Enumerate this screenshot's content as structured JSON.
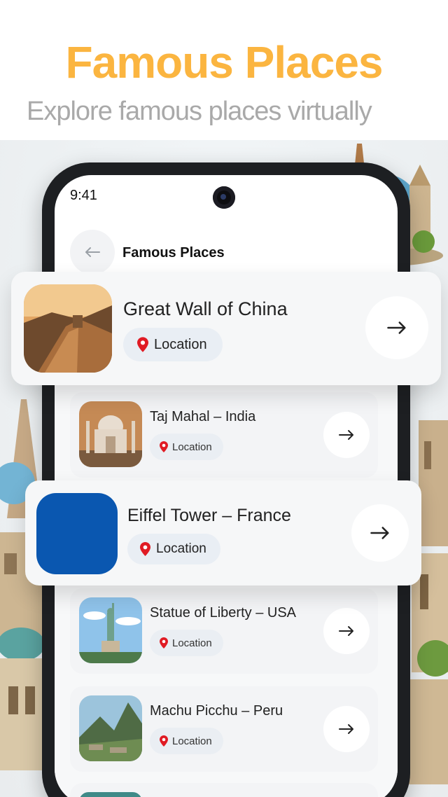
{
  "hero": {
    "title": "Famous Places",
    "subtitle": "Explore famous places virtually"
  },
  "status_bar": {
    "time": "9:41"
  },
  "header": {
    "back_icon": "arrow-left-icon",
    "title": "Famous Places"
  },
  "featured_cards": [
    {
      "title": "Great Wall of China",
      "location_label": "Location"
    },
    {
      "title": "Eiffel Tower – France",
      "location_label": "Location"
    }
  ],
  "places": [
    {
      "title": "Taj Mahal – India",
      "location_label": "Location"
    },
    {
      "title": "Statue of Liberty – USA",
      "location_label": "Location"
    },
    {
      "title": "Machu Picchu – Peru",
      "location_label": "Location"
    }
  ],
  "colors": {
    "accent": "#fbb540",
    "subtitle": "#a9a9a9",
    "pin": "#e01b24",
    "eiffel_placeholder": "#0a57b0"
  },
  "icons": {
    "arrow": "arrow-right-icon",
    "pin": "location-pin-icon"
  }
}
